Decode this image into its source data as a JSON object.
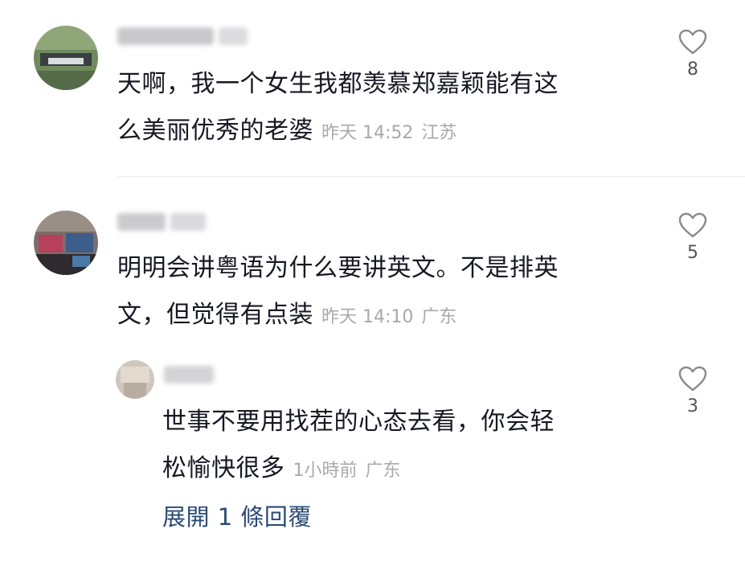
{
  "comments": [
    {
      "text_line1": "天啊，我一个女生我都羡慕郑嘉颖能有这",
      "text_line2": "么美丽优秀的老婆",
      "time": "昨天 14:52",
      "location": "江苏",
      "likes": "8"
    },
    {
      "text_line1": "明明会讲粤语为什么要讲英文。不是排英",
      "text_line2": "文，但觉得有点装",
      "time": "昨天 14:10",
      "location": "广东",
      "likes": "5"
    }
  ],
  "reply": {
    "text_line1": "世事不要用找茬的心态去看，你会轻",
    "text_line2": "松愉快很多",
    "time": "1小時前",
    "location": "广东",
    "likes": "3"
  },
  "expand_replies": "展開 1 條回覆",
  "icons": {
    "like": "heart-outline-icon"
  },
  "colors": {
    "text": "#161823",
    "meta": "#a9a9ad",
    "link": "#2c4b73"
  }
}
